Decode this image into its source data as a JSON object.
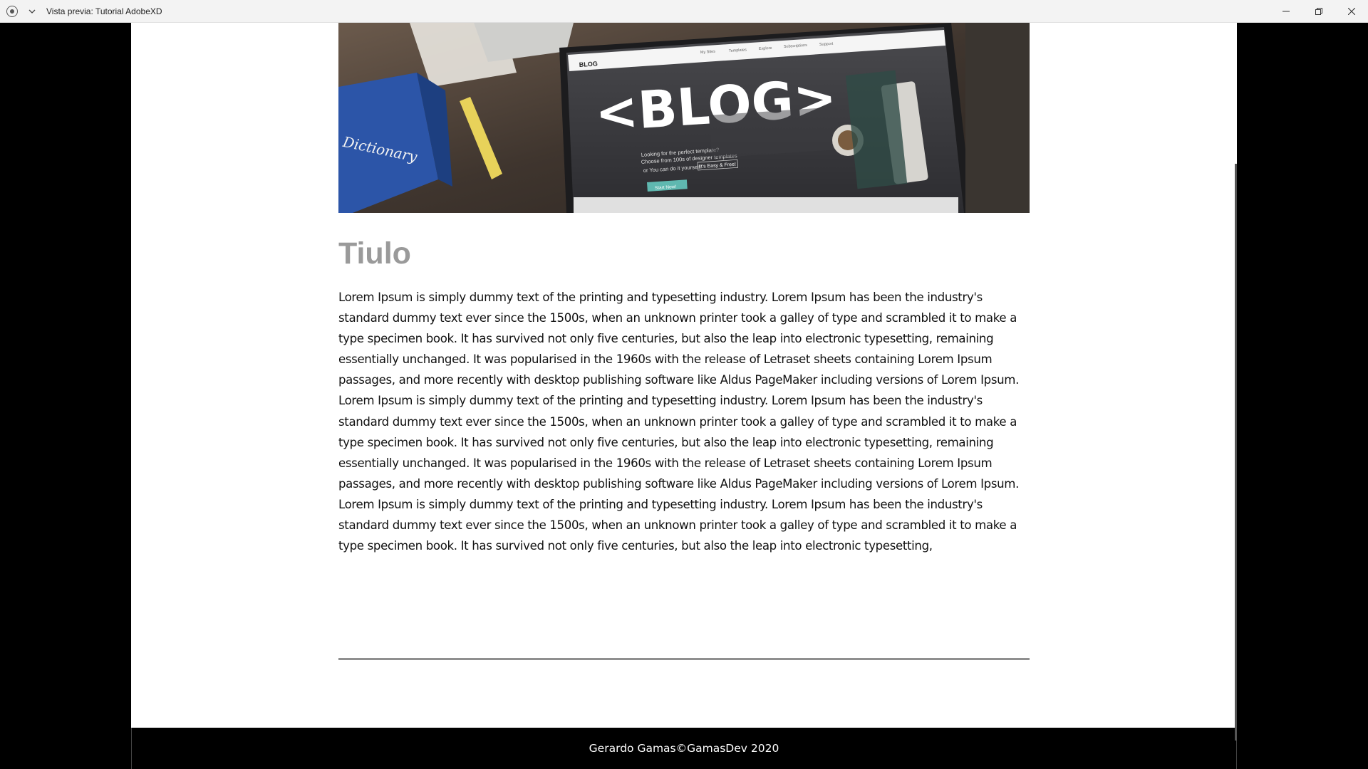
{
  "window": {
    "title": "Vista previa: Tutorial AdobeXD"
  },
  "hero": {
    "icon": "blog-laptop-image",
    "nav_brand": "BLOG",
    "nav_items": [
      "My Sites",
      "Templates",
      "Explore",
      "Subscriptions",
      "Support"
    ],
    "headline": "<BLOG>",
    "tagline_1": "Looking for the perfect template?",
    "tagline_2": "Choose from 100s of designer templates",
    "tagline_3": "or You can do it yourself.",
    "tagline_badge": "It's Easy & Free!",
    "cta": "Start Now!",
    "book_label": "Dictionary"
  },
  "post": {
    "title": "Tiulo",
    "paragraphs": [
      "Lorem Ipsum is simply dummy text of the printing and typesetting industry. Lorem Ipsum has been the industry's standard dummy text ever since the 1500s, when an unknown printer took a galley of type and scrambled it to make a type specimen book. It has survived not only five centuries, but also the leap into electronic typesetting, remaining essentially unchanged. It was popularised in the 1960s with the release of Letraset sheets containing Lorem Ipsum passages, and more recently with desktop publishing software like Aldus PageMaker including versions of Lorem Ipsum.",
      "Lorem Ipsum is simply dummy text of the printing and typesetting industry. Lorem Ipsum has been the industry's standard dummy text ever since the 1500s, when an unknown printer took a galley of type and scrambled it to make a type specimen book. It has survived not only five centuries, but also the leap into electronic typesetting, remaining essentially unchanged. It was popularised in the 1960s with the release of Letraset sheets containing Lorem Ipsum passages, and more recently with desktop publishing software like Aldus PageMaker including versions of Lorem Ipsum.",
      "Lorem Ipsum is simply dummy text of the printing and typesetting industry. Lorem Ipsum has been the industry's standard dummy text ever since the 1500s, when an unknown printer took a galley of type and scrambled it to make a type specimen book. It has survived not only five centuries, but also the leap into electronic typesetting,"
    ]
  },
  "footer": {
    "text": "Gerardo Gamas©GamasDev 2020"
  },
  "colors": {
    "title_gray": "#9a9a9a",
    "divider": "#8f8f8f",
    "cta_teal": "#5fb8b0"
  }
}
